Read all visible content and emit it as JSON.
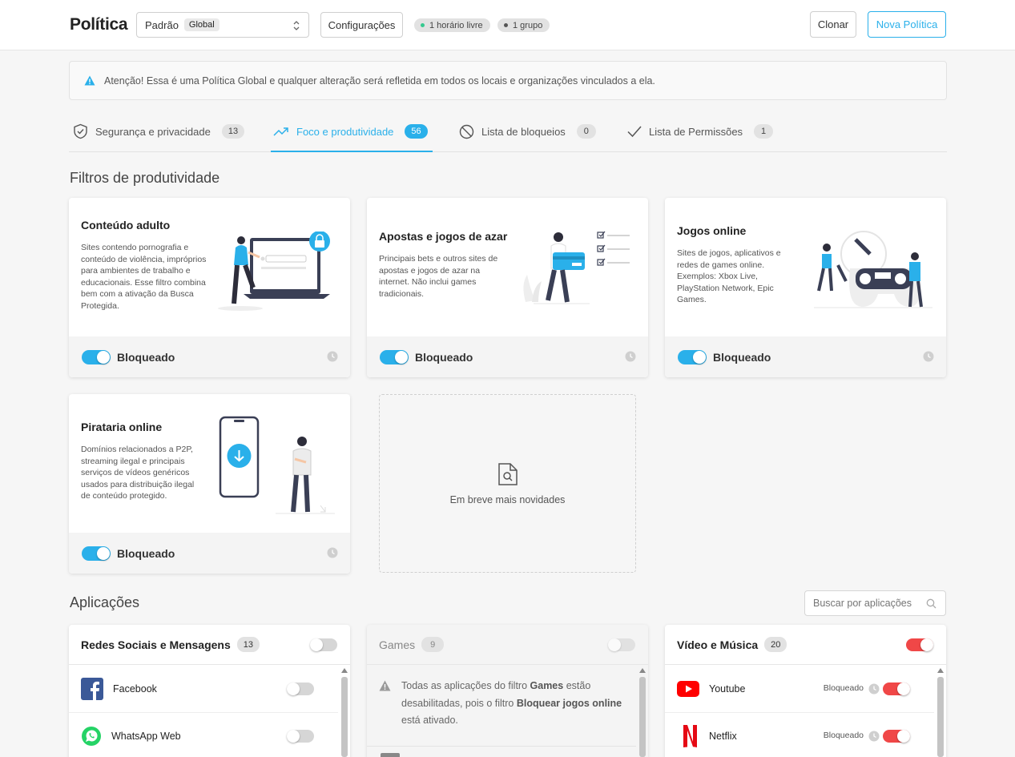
{
  "header": {
    "title": "Política",
    "policy_select": {
      "value": "Padrão",
      "tag": "Global"
    },
    "config_button": "Configurações",
    "chips": [
      {
        "label": "1 horário livre",
        "dot_color": "#35c98f"
      },
      {
        "label": "1 grupo",
        "dot_color": "#555555"
      }
    ],
    "clone_button": "Clonar",
    "new_button": "Nova Política"
  },
  "alert": {
    "text": "Atenção! Essa é uma Política Global e qualquer alteração será refletida em todos os locais e organizações vinculados a ela."
  },
  "tabs": [
    {
      "label": "Segurança e privacidade",
      "count": "13",
      "active": false
    },
    {
      "label": "Foco e produtividade",
      "count": "56",
      "active": true
    },
    {
      "label": "Lista de bloqueios",
      "count": "0",
      "active": false
    },
    {
      "label": "Lista de Permissões",
      "count": "1",
      "active": false
    }
  ],
  "filters": {
    "section_title": "Filtros de produtividade",
    "cards": [
      {
        "title": "Conteúdo adulto",
        "description": "Sites contendo pornografia e conteúdo de violência, impróprios para ambientes de trabalho e educacionais. Esse filtro combina bem com a ativação da Busca Protegida.",
        "status": "Bloqueado",
        "enabled": true
      },
      {
        "title": "Apostas e jogos de azar",
        "description": "Principais bets e outros sites de apostas e jogos de azar na internet. Não inclui games tradicionais.",
        "status": "Bloqueado",
        "enabled": true
      },
      {
        "title": "Jogos online",
        "description": "Sites de jogos, aplicativos e redes de games online. Exemplos: Xbox Live, PlayStation Network, Epic Games.",
        "status": "Bloqueado",
        "enabled": true
      },
      {
        "title": "Pirataria online",
        "description": "Domínios relacionados a P2P, streaming ilegal e principais serviços de vídeos genéricos usados para distribuição ilegal de conteúdo protegido.",
        "status": "Bloqueado",
        "enabled": true
      }
    ],
    "coming_soon": "Em breve mais novidades"
  },
  "applications": {
    "section_title": "Aplicações",
    "search_placeholder": "Buscar por aplicações",
    "groups": [
      {
        "title": "Redes Sociais e Mensagens",
        "count": "13",
        "enabled": false,
        "apps": [
          {
            "name": "Facebook",
            "icon": "facebook-icon"
          },
          {
            "name": "WhatsApp Web",
            "icon": "whatsapp-icon"
          }
        ]
      },
      {
        "title": "Games",
        "count": "9",
        "enabled": false,
        "disabled": true,
        "message": {
          "p1": "Todas as aplicações do filtro ",
          "b1": "Games",
          "p2": " estão desabilitadas, pois o filtro ",
          "b2": "Bloquear jogos online",
          "p3": " está ativado."
        }
      },
      {
        "title": "Vídeo e Música",
        "count": "20",
        "enabled": true,
        "apps": [
          {
            "name": "Youtube",
            "icon": "youtube-icon",
            "status": "Bloqueado"
          },
          {
            "name": "Netflix",
            "icon": "netflix-icon",
            "status": "Bloqueado"
          }
        ]
      }
    ]
  },
  "colors": {
    "accent": "#2ab0ea",
    "danger_toggle": "#f04747"
  }
}
